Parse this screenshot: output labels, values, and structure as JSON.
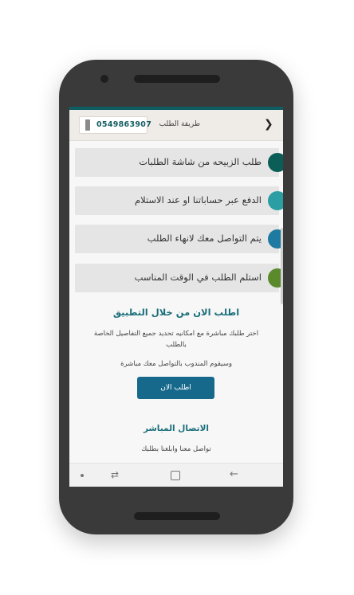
{
  "header": {
    "title": "طريقة الطلب",
    "phone": "0549863907",
    "back_icon": "chevron-right-icon",
    "phone_icon": "phone-icon"
  },
  "steps": [
    {
      "label": "طلب الزبيحه من شاشة الطلبات",
      "color": "#0b5e57"
    },
    {
      "label": "الدفع عبر حساباتنا او عند الاستلام",
      "color": "#2a9ea3"
    },
    {
      "label": "يتم التواصل معك لانهاء الطلب",
      "color": "#1e7aa0"
    },
    {
      "label": "استلم الطلب في الوقت المناسب",
      "color": "#5b8a2d"
    }
  ],
  "order_section": {
    "title": "اطلب الان من خلال التطبيق",
    "description": "اختر طلبك مباشرة مع امكانيه تحديد جميع التفاصيل الخاصة بالطلب",
    "note": "وسيقوم المندوب بالتواصل معك مباشرة",
    "button_label": "اطلب الان"
  },
  "contact_section": {
    "title": "الاتصال المباشر",
    "subtitle": "تواصل معنا وابلغنا بطلبك"
  },
  "navbar": {
    "dot_icon": "dot-icon",
    "recent_icon": "recent-apps-icon",
    "home_icon": "home-icon",
    "back_icon": "back-arrow-icon",
    "recent_glyph": "⇄",
    "back_glyph": "←"
  },
  "colors": {
    "accent": "#0e5d63",
    "button": "#17698c",
    "title": "#1a6e7a"
  }
}
